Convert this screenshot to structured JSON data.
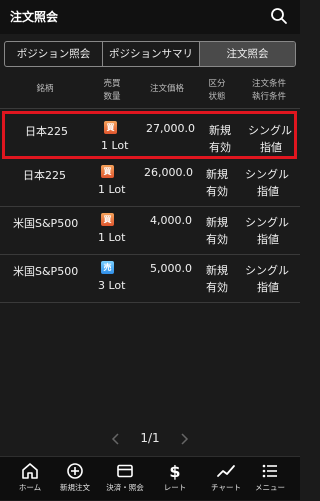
{
  "header": {
    "title": "注文照会",
    "search_icon": "search-icon"
  },
  "tabs": [
    {
      "label": "ポジション照会",
      "active": false
    },
    {
      "label": "ポジションサマリ",
      "active": false
    },
    {
      "label": "注文照会",
      "active": true
    }
  ],
  "table": {
    "headers": {
      "symbol": "銘柄",
      "side_line1": "売買",
      "side_line2": "数量",
      "price": "注文価格",
      "type_line1": "区分",
      "type_line2": "状態",
      "cond_line1": "注文条件",
      "cond_line2": "執行条件"
    },
    "rows": [
      {
        "symbol": "日本225",
        "side": "買",
        "side_kind": "buy",
        "qty": "1 Lot",
        "price": "27,000.0",
        "type": "新規",
        "status": "有効",
        "cond": "シングル",
        "exec": "指値",
        "selected": true
      },
      {
        "symbol": "日本225",
        "side": "買",
        "side_kind": "buy",
        "qty": "1 Lot",
        "price": "26,000.0",
        "type": "新規",
        "status": "有効",
        "cond": "シングル",
        "exec": "指値",
        "selected": false
      },
      {
        "symbol": "米国S&P500",
        "side": "買",
        "side_kind": "buy",
        "qty": "1 Lot",
        "price": "4,000.0",
        "type": "新規",
        "status": "有効",
        "cond": "シングル",
        "exec": "指値",
        "selected": false
      },
      {
        "symbol": "米国S&P500",
        "side": "売",
        "side_kind": "sell",
        "qty": "3 Lot",
        "price": "5,000.0",
        "type": "新規",
        "status": "有効",
        "cond": "シングル",
        "exec": "指値",
        "selected": false
      }
    ]
  },
  "pager": {
    "text": "1/1"
  },
  "bottom_nav": [
    {
      "label": "ホーム",
      "icon": "home-icon"
    },
    {
      "label": "新規注文",
      "icon": "plus-circle-icon"
    },
    {
      "label": "決済・照会",
      "icon": "card-icon"
    },
    {
      "label": "レート",
      "icon": "dollar-icon"
    },
    {
      "label": "チャート",
      "icon": "chart-line-icon"
    },
    {
      "label": "メニュー",
      "icon": "menu-icon"
    }
  ],
  "colors": {
    "accent_selected": "#e0161f",
    "buy_badge": "#e0562e",
    "sell_badge": "#2f8ee8",
    "background": "#1b1b1b"
  }
}
